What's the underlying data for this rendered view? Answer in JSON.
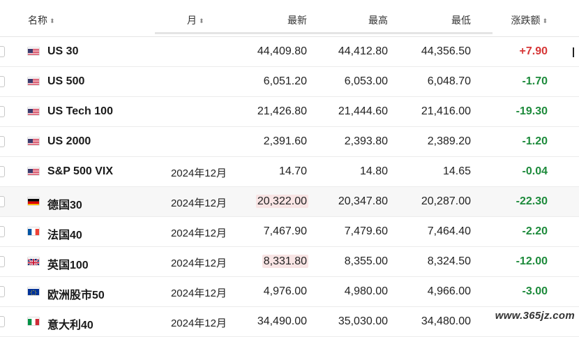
{
  "header": {
    "name": "名称",
    "month": "月",
    "last": "最新",
    "high": "最高",
    "low": "最低",
    "change": "涨跌额",
    "sort_glyph": "⬍"
  },
  "rows": [
    {
      "flag": "us",
      "name": "US 30",
      "month": "",
      "last": "44,409.80",
      "high": "44,412.80",
      "low": "44,356.50",
      "change": "+7.90",
      "dir": "up"
    },
    {
      "flag": "us",
      "name": "US 500",
      "month": "",
      "last": "6,051.20",
      "high": "6,053.00",
      "low": "6,048.70",
      "change": "-1.70",
      "dir": "down"
    },
    {
      "flag": "us",
      "name": "US Tech 100",
      "month": "",
      "last": "21,426.80",
      "high": "21,444.60",
      "low": "21,416.00",
      "change": "-19.30",
      "dir": "down"
    },
    {
      "flag": "us",
      "name": "US 2000",
      "month": "",
      "last": "2,391.60",
      "high": "2,393.80",
      "low": "2,389.20",
      "change": "-1.20",
      "dir": "down"
    },
    {
      "flag": "us",
      "name": "S&P 500 VIX",
      "month": "2024年12月",
      "last": "14.70",
      "high": "14.80",
      "low": "14.65",
      "change": "-0.04",
      "dir": "down"
    },
    {
      "flag": "de",
      "name": "德国30",
      "month": "2024年12月",
      "last": "20,322.00",
      "high": "20,347.80",
      "low": "20,287.00",
      "change": "-22.30",
      "dir": "down",
      "flash": true,
      "highlight": true
    },
    {
      "flag": "fr",
      "name": "法国40",
      "month": "2024年12月",
      "last": "7,467.90",
      "high": "7,479.60",
      "low": "7,464.40",
      "change": "-2.20",
      "dir": "down"
    },
    {
      "flag": "gb",
      "name": "英国100",
      "month": "2024年12月",
      "last": "8,331.80",
      "high": "8,355.00",
      "low": "8,324.50",
      "change": "-12.00",
      "dir": "down",
      "flash": true
    },
    {
      "flag": "eu",
      "name": "欧洲股市50",
      "month": "2024年12月",
      "last": "4,976.00",
      "high": "4,980.00",
      "low": "4,966.00",
      "change": "-3.00",
      "dir": "down"
    },
    {
      "flag": "it",
      "name": "意大利40",
      "month": "2024年12月",
      "last": "34,490.00",
      "high": "35,030.00",
      "low": "34,480.00",
      "change": "",
      "dir": "down"
    }
  ],
  "watermark": "www.365jz.com",
  "colors": {
    "up": "#d63636",
    "down": "#1d8a3b",
    "flash_bg": "#f8e4e4"
  }
}
